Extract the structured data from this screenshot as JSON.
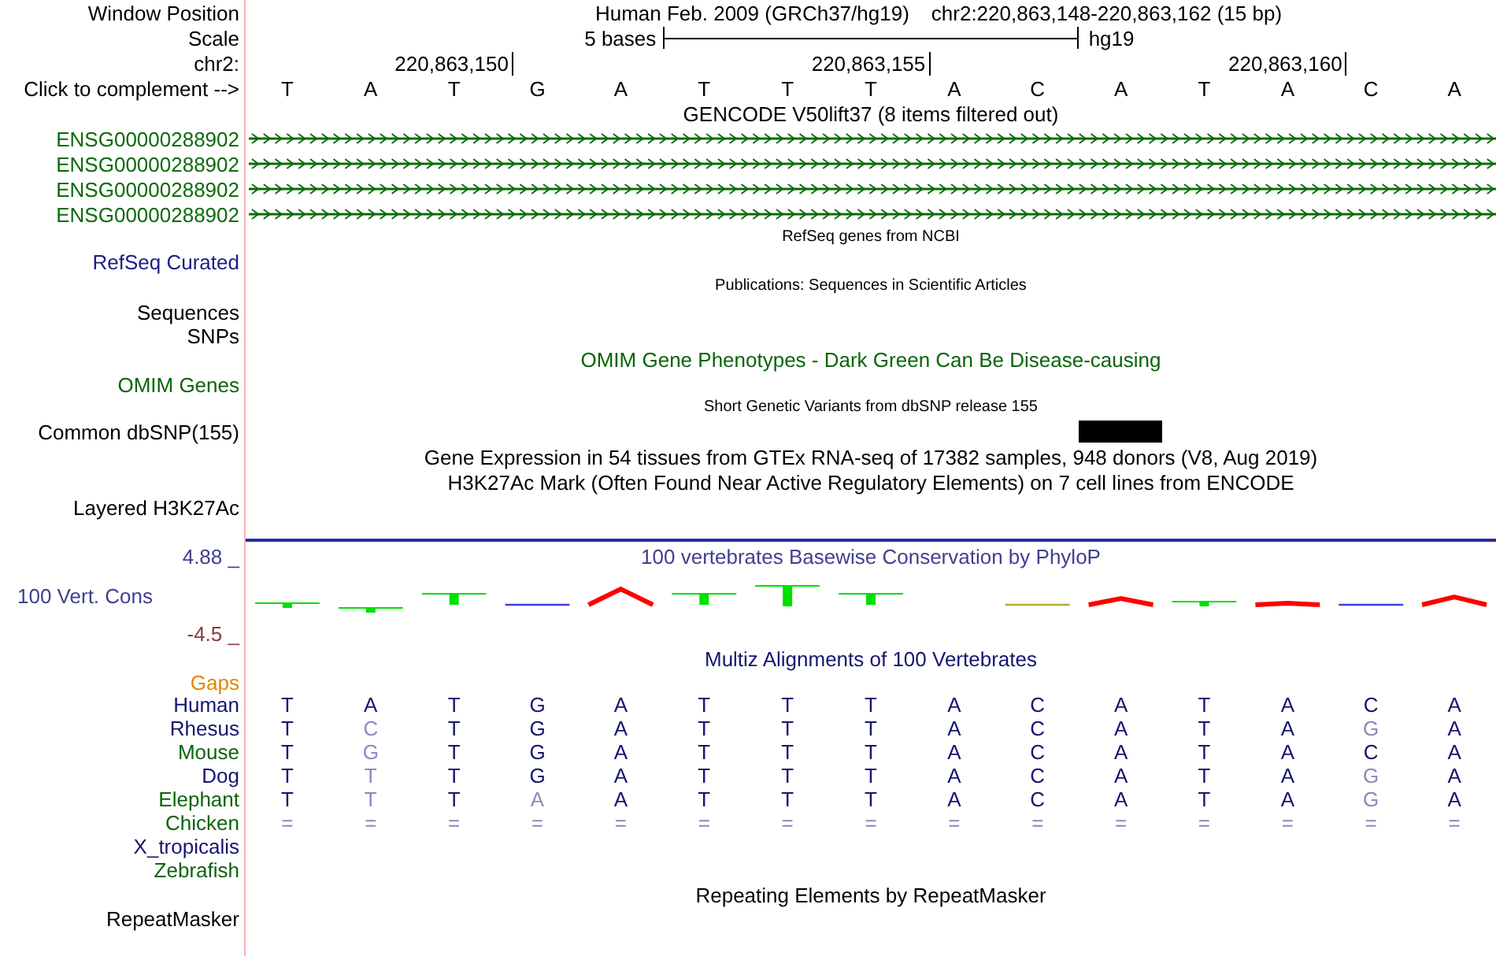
{
  "header": {
    "position_label": "Window Position",
    "assembly_title": "Human Feb. 2009 (GRCh37/hg19)",
    "position": "chr2:220,863,148-220,863,162 (15 bp)",
    "scale_label": "Scale",
    "scale_text": "5 bases",
    "scale_assembly": "hg19",
    "chrom_label": "chr2:",
    "complement_label": "Click to complement -->"
  },
  "bases": [
    {
      "letter": "T"
    },
    {
      "letter": "A"
    },
    {
      "letter": "T",
      "tick": "220,863,150"
    },
    {
      "letter": "G"
    },
    {
      "letter": "A"
    },
    {
      "letter": "T"
    },
    {
      "letter": "T"
    },
    {
      "letter": "T",
      "tick": "220,863,155"
    },
    {
      "letter": "A"
    },
    {
      "letter": "C"
    },
    {
      "letter": "A"
    },
    {
      "letter": "T"
    },
    {
      "letter": "A",
      "tick": "220,863,160"
    },
    {
      "letter": "C"
    },
    {
      "letter": "A"
    }
  ],
  "gencode": {
    "title": "GENCODE V50lift37 (8 items filtered out)",
    "items": [
      {
        "name": "ENSG00000288902"
      },
      {
        "name": "ENSG00000288902"
      },
      {
        "name": "ENSG00000288902"
      },
      {
        "name": "ENSG00000288902"
      }
    ]
  },
  "refseq": {
    "title": "RefSeq genes from NCBI",
    "label": "RefSeq Curated"
  },
  "publications": {
    "title": "Publications: Sequences in Scientific Articles",
    "labels": [
      "Sequences",
      "SNPs"
    ]
  },
  "omim": {
    "title": "OMIM Gene Phenotypes - Dark Green Can Be Disease-causing",
    "label": "OMIM Genes"
  },
  "dbsnp": {
    "title": "Short Genetic Variants from dbSNP release 155",
    "label": "Common dbSNP(155)",
    "positions": [
      {
        "variant": false
      },
      {
        "variant": false
      },
      {
        "variant": false
      },
      {
        "variant": false
      },
      {
        "variant": false
      },
      {
        "variant": false
      },
      {
        "variant": false
      },
      {
        "variant": false
      },
      {
        "variant": false
      },
      {
        "variant": false
      },
      {
        "variant": true
      },
      {
        "variant": false
      },
      {
        "variant": false
      },
      {
        "variant": false
      },
      {
        "variant": false
      }
    ]
  },
  "gtex": {
    "title": "Gene Expression in 54 tissues from GTEx RNA-seq of 17382 samples, 948 donors (V8, Aug 2019)"
  },
  "h3k27ac": {
    "title": "H3K27Ac Mark (Often Found Near Active Regulatory Elements) on 7 cell lines from ENCODE",
    "label": "Layered H3K27Ac"
  },
  "conservation": {
    "title": "100 vertebrates Basewise Conservation by PhyloP",
    "label": "100 Vert. Cons",
    "y_max": "4.88 _",
    "y_min": "-4.5 _"
  },
  "multiz": {
    "title": "Multiz Alignments of 100 Vertebrates",
    "gaps_label": "Gaps",
    "species": [
      {
        "name": "Human",
        "color": "#141470",
        "bases": [
          {
            "b": "T",
            "match": true
          },
          {
            "b": "A",
            "match": true
          },
          {
            "b": "T",
            "match": true
          },
          {
            "b": "G",
            "match": true
          },
          {
            "b": "A",
            "match": true
          },
          {
            "b": "T",
            "match": true
          },
          {
            "b": "T",
            "match": true
          },
          {
            "b": "T",
            "match": true
          },
          {
            "b": "A",
            "match": true
          },
          {
            "b": "C",
            "match": true
          },
          {
            "b": "A",
            "match": true
          },
          {
            "b": "T",
            "match": true
          },
          {
            "b": "A",
            "match": true
          },
          {
            "b": "C",
            "match": true
          },
          {
            "b": "A",
            "match": true
          }
        ]
      },
      {
        "name": "Rhesus",
        "color": "#141470",
        "bases": [
          {
            "b": "T",
            "match": true
          },
          {
            "b": "C",
            "match": false
          },
          {
            "b": "T",
            "match": true
          },
          {
            "b": "G",
            "match": true
          },
          {
            "b": "A",
            "match": true
          },
          {
            "b": "T",
            "match": true
          },
          {
            "b": "T",
            "match": true
          },
          {
            "b": "T",
            "match": true
          },
          {
            "b": "A",
            "match": true
          },
          {
            "b": "C",
            "match": true
          },
          {
            "b": "A",
            "match": true
          },
          {
            "b": "T",
            "match": true
          },
          {
            "b": "A",
            "match": true
          },
          {
            "b": "G",
            "match": false
          },
          {
            "b": "A",
            "match": true
          }
        ]
      },
      {
        "name": "Mouse",
        "color": "#0a640a",
        "bases": [
          {
            "b": "T",
            "match": true
          },
          {
            "b": "G",
            "match": false
          },
          {
            "b": "T",
            "match": true
          },
          {
            "b": "G",
            "match": true
          },
          {
            "b": "A",
            "match": true
          },
          {
            "b": "T",
            "match": true
          },
          {
            "b": "T",
            "match": true
          },
          {
            "b": "T",
            "match": true
          },
          {
            "b": "A",
            "match": true
          },
          {
            "b": "C",
            "match": true
          },
          {
            "b": "A",
            "match": true
          },
          {
            "b": "T",
            "match": true
          },
          {
            "b": "A",
            "match": true
          },
          {
            "b": "C",
            "match": true
          },
          {
            "b": "A",
            "match": true
          }
        ]
      },
      {
        "name": "Dog",
        "color": "#141470",
        "bases": [
          {
            "b": "T",
            "match": true
          },
          {
            "b": "T",
            "match": false
          },
          {
            "b": "T",
            "match": true
          },
          {
            "b": "G",
            "match": true
          },
          {
            "b": "A",
            "match": true
          },
          {
            "b": "T",
            "match": true
          },
          {
            "b": "T",
            "match": true
          },
          {
            "b": "T",
            "match": true
          },
          {
            "b": "A",
            "match": true
          },
          {
            "b": "C",
            "match": true
          },
          {
            "b": "A",
            "match": true
          },
          {
            "b": "T",
            "match": true
          },
          {
            "b": "A",
            "match": true
          },
          {
            "b": "G",
            "match": false
          },
          {
            "b": "A",
            "match": true
          }
        ]
      },
      {
        "name": "Elephant",
        "color": "#0a640a",
        "bases": [
          {
            "b": "T",
            "match": true
          },
          {
            "b": "T",
            "match": false
          },
          {
            "b": "T",
            "match": true
          },
          {
            "b": "A",
            "match": false
          },
          {
            "b": "A",
            "match": true
          },
          {
            "b": "T",
            "match": true
          },
          {
            "b": "T",
            "match": true
          },
          {
            "b": "T",
            "match": true
          },
          {
            "b": "A",
            "match": true
          },
          {
            "b": "C",
            "match": true
          },
          {
            "b": "A",
            "match": true
          },
          {
            "b": "T",
            "match": true
          },
          {
            "b": "A",
            "match": true
          },
          {
            "b": "G",
            "match": false
          },
          {
            "b": "A",
            "match": true
          }
        ]
      },
      {
        "name": "Chicken",
        "color": "#0a640a",
        "bases": [
          {
            "b": "=",
            "match": false
          },
          {
            "b": "=",
            "match": false
          },
          {
            "b": "=",
            "match": false
          },
          {
            "b": "=",
            "match": false
          },
          {
            "b": "=",
            "match": false
          },
          {
            "b": "=",
            "match": false
          },
          {
            "b": "=",
            "match": false
          },
          {
            "b": "=",
            "match": false
          },
          {
            "b": "=",
            "match": false
          },
          {
            "b": "=",
            "match": false
          },
          {
            "b": "=",
            "match": false
          },
          {
            "b": "=",
            "match": false
          },
          {
            "b": "=",
            "match": false
          },
          {
            "b": "=",
            "match": false
          },
          {
            "b": "=",
            "match": false
          }
        ]
      },
      {
        "name": "X_tropicalis",
        "color": "#141470"
      },
      {
        "name": "Zebrafish",
        "color": "#0a640a"
      }
    ]
  },
  "repeatmasker": {
    "title": "Repeating Elements by RepeatMasker",
    "label": "RepeatMasker"
  }
}
